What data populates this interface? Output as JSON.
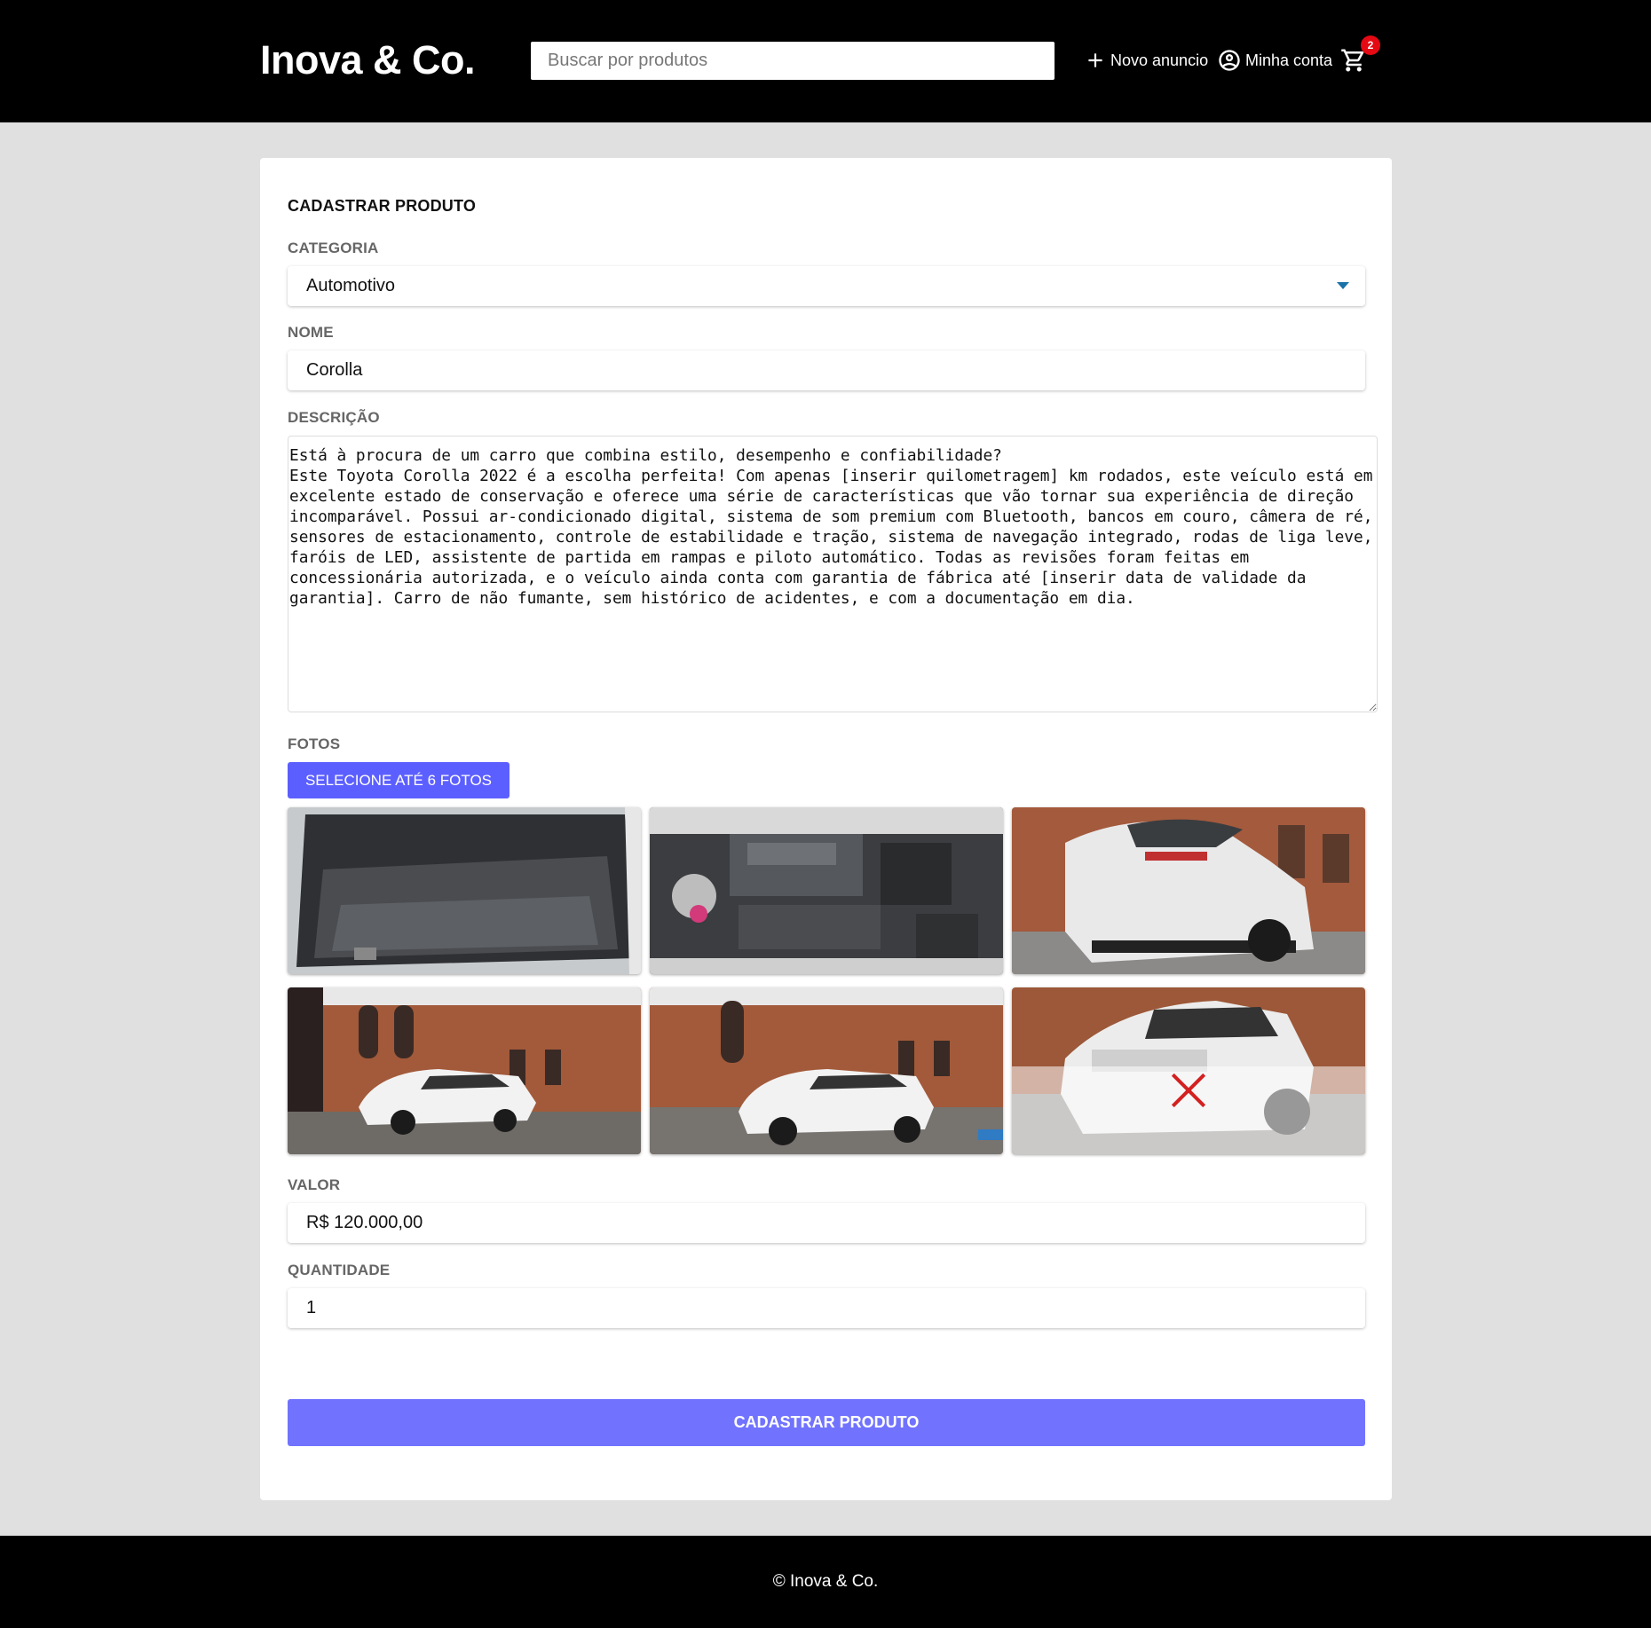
{
  "header": {
    "brand": "Inova & Co.",
    "search_placeholder": "Buscar por produtos",
    "new_listing_label": "Novo anuncio",
    "account_label": "Minha conta",
    "cart_count": "2",
    "icons": [
      "plus-icon",
      "account-circle-icon",
      "cart-icon"
    ]
  },
  "form": {
    "title": "CADASTRAR PRODUTO",
    "category": {
      "label": "CATEGORIA",
      "value": "Automotivo"
    },
    "name": {
      "label": "NOME",
      "value": "Corolla"
    },
    "description": {
      "label": "DESCRIÇÃO",
      "value": "Está à procura de um carro que combina estilo, desempenho e confiabilidade?\nEste Toyota Corolla 2022 é a escolha perfeita! Com apenas [inserir quilometragem] km rodados, este veículo está em excelente estado de conservação e oferece uma série de características que vão tornar sua experiência de direção incomparável. Possui ar-condicionado digital, sistema de som premium com Bluetooth, bancos em couro, câmera de ré, sensores de estacionamento, controle de estabilidade e tração, sistema de navegação integrado, rodas de liga leve, faróis de LED, assistente de partida em rampas e piloto automático. Todas as revisões foram feitas em concessionária autorizada, e o veículo ainda conta com garantia de fábrica até [inserir data de validade da garantia]. Carro de não fumante, sem histórico de acidentes, e com a documentação em dia."
    },
    "photos": {
      "label": "FOTOS",
      "button_label": "SELECIONE ATÉ 6 FOTOS",
      "items": [
        "trunk-photo",
        "engine-photo",
        "rear-photo",
        "side-photo-1",
        "side-photo-2",
        "front-photo"
      ]
    },
    "price": {
      "label": "VALOR",
      "value": "R$ 120.000,00"
    },
    "quantity": {
      "label": "QUANTIDADE",
      "value": "1"
    },
    "submit_label": "CADASTRAR PRODUTO"
  },
  "footer": {
    "text": "© Inova & Co."
  },
  "colors": {
    "accent": "#5c5fff",
    "submit": "#7173ff",
    "badge": "#e50914",
    "header_bg": "#000000"
  }
}
